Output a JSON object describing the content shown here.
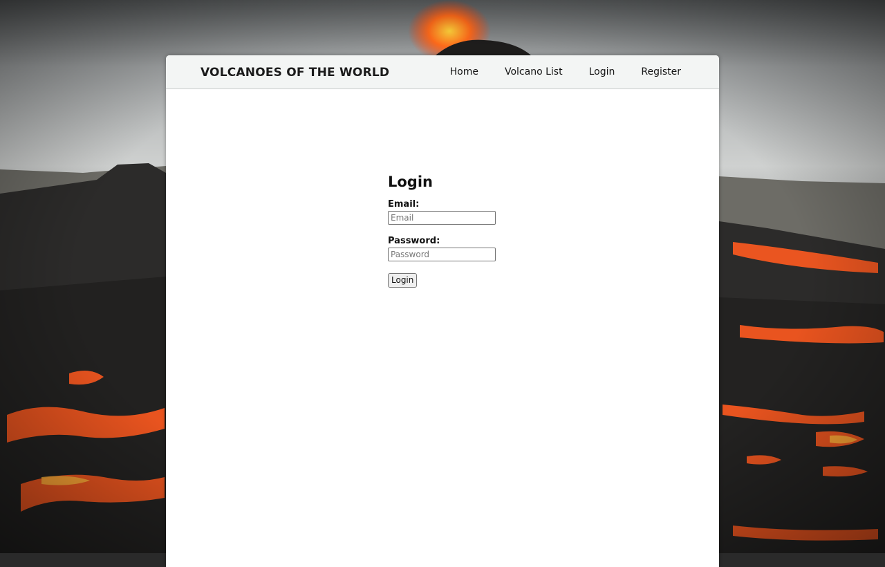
{
  "navbar": {
    "brand": "VOLCANOES OF THE WORLD",
    "links": [
      {
        "label": "Home"
      },
      {
        "label": "Volcano List"
      },
      {
        "label": "Login"
      },
      {
        "label": "Register"
      }
    ]
  },
  "login_form": {
    "title": "Login",
    "email": {
      "label": "Email:",
      "placeholder": "Email",
      "value": ""
    },
    "password": {
      "label": "Password:",
      "placeholder": "Password",
      "value": ""
    },
    "submit_label": "Login"
  },
  "colors": {
    "panel_background": "#ffffff",
    "navbar_background": "#f3f5f4",
    "lava_accent": "#ff5a1f"
  }
}
